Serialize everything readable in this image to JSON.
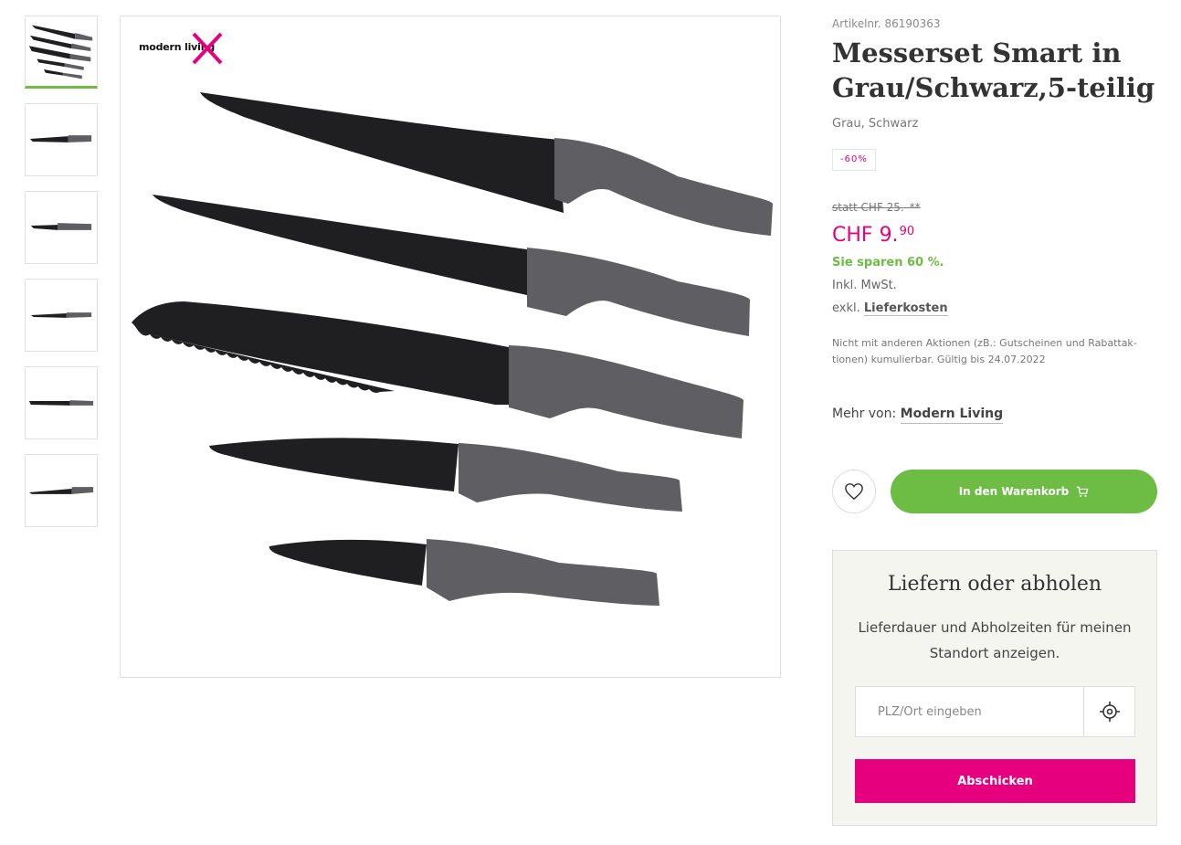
{
  "gallery": {
    "brand_logo_text": "modern living",
    "thumbnails": [
      "knife-set-thumbnail",
      "single-knife-thumbnail",
      "paring-knife-thumbnail",
      "utility-knife-thumbnail",
      "bread-knife-thumbnail",
      "chef-knife-thumbnail"
    ]
  },
  "product": {
    "article_number": "Artikelnr. 86190363",
    "title_bold": "Messerset",
    "title_rest": " Smart in Grau/Schwarz,5-teilig",
    "colors": "Grau, Schwarz",
    "discount_badge": "-60%"
  },
  "pricing": {
    "old_price": "statt CHF 25.–**",
    "currency": "CHF",
    "price_main": "9.",
    "price_cents": "90",
    "saving": "Sie sparen 60 %.",
    "vat": "Inkl. MwSt.",
    "shipping_prefix": "exkl.",
    "shipping_link": "Lieferkosten",
    "note": "Nicht mit anderen Aktionen (zB.: Gutscheinen und Rabattak-tionen) kumulierbar. Gültig bis 24.07.2022"
  },
  "brand": {
    "prefix": "Mehr von:",
    "link": "Modern Living"
  },
  "actions": {
    "cart_label": "In den Warenkorb"
  },
  "delivery": {
    "title": "Liefern oder abholen",
    "description": "Lieferdauer und Abholzeiten für meinen Standort anzeigen.",
    "zip_placeholder": "PLZ/Ort eingeben",
    "submit_label": "Abschicken"
  },
  "colors": {
    "accent_pink": "#e6007e",
    "accent_green": "#6dbd45",
    "blade": "#1f1f21",
    "handle": "#5f5f63"
  }
}
